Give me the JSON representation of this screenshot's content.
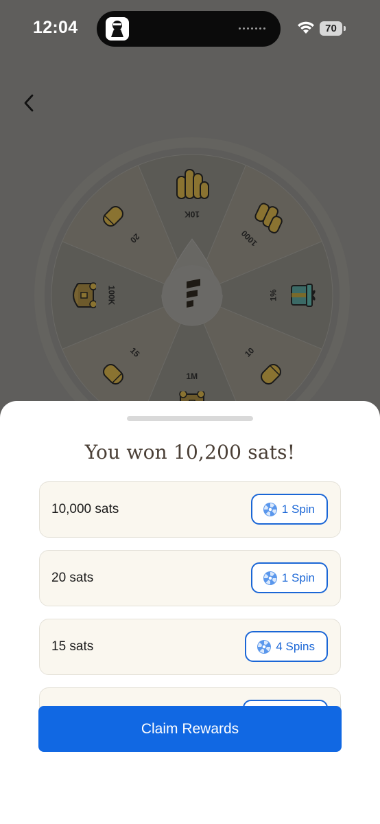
{
  "status_bar": {
    "time": "12:04",
    "battery": "70"
  },
  "wheel": {
    "segments": [
      {
        "label": "10K",
        "icon": "coin-stack-icon"
      },
      {
        "label": "1000",
        "icon": "coin-pile-icon"
      },
      {
        "label": "1%",
        "icon": "gift-box-icon"
      },
      {
        "label": "10",
        "icon": "coin-roll-icon"
      },
      {
        "label": "1M",
        "icon": "treasure-chest-icon"
      },
      {
        "label": "15",
        "icon": "coin-roll-icon"
      },
      {
        "label": "100K",
        "icon": "treasure-chest-icon"
      },
      {
        "label": "20",
        "icon": "coin-roll-icon"
      }
    ]
  },
  "sheet": {
    "title": "You won 10,200 sats!",
    "rewards": [
      {
        "amount": "10,000 sats",
        "spins": "1 Spin"
      },
      {
        "amount": "20 sats",
        "spins": "1 Spin"
      },
      {
        "amount": "15 sats",
        "spins": "4 Spins"
      }
    ],
    "claim_label": "Claim Rewards"
  },
  "colors": {
    "accent": "#1168e3",
    "badge": "#1a66d6",
    "row_bg": "#faf7ef",
    "overlay": "#5f5e5c",
    "coin": "#e0b332"
  }
}
